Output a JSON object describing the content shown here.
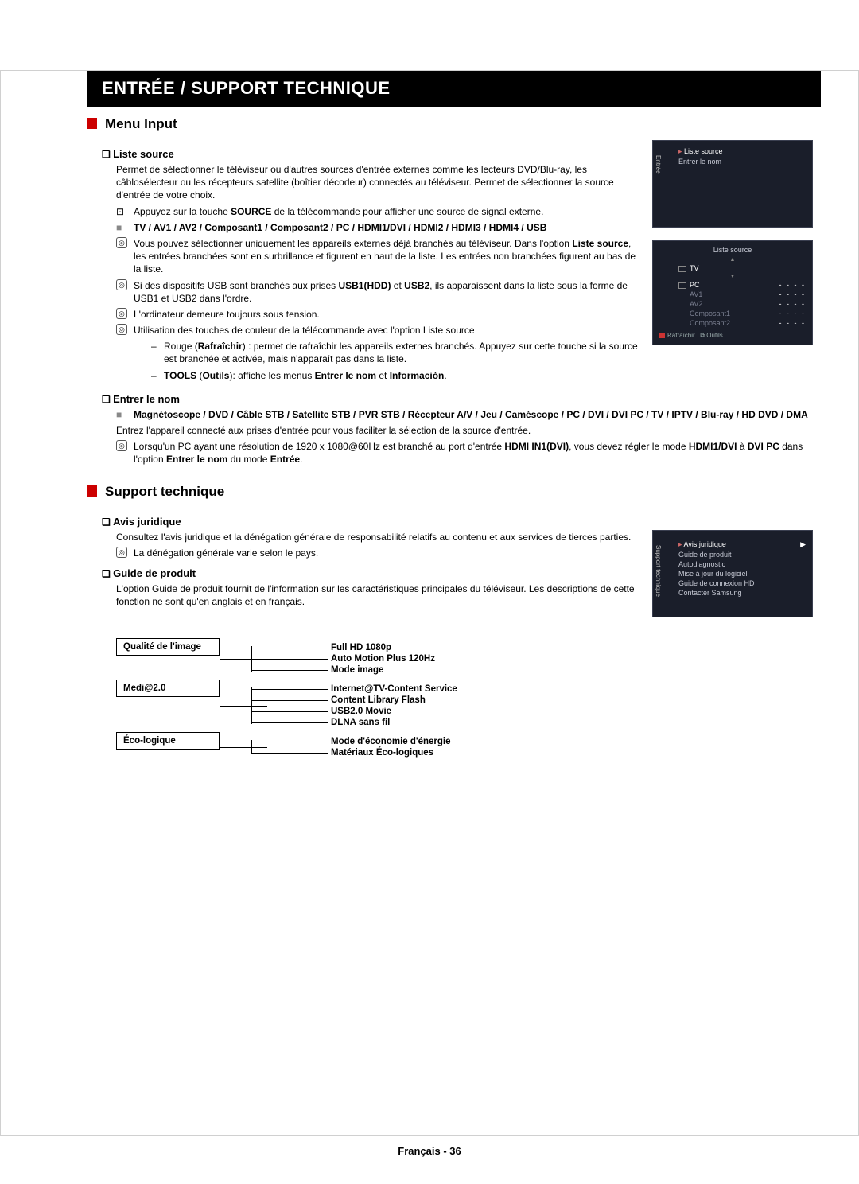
{
  "banner": "ENTRÉE / SUPPORT TECHNIQUE",
  "section1": {
    "title": "Menu Input",
    "liste_source": {
      "heading": "Liste source",
      "p1": "Permet de sélectionner le téléviseur ou d'autres sources d'entrée externes comme les lecteurs DVD/Blu-ray, les câblosélecteur ou les récepteurs satellite (boîtier décodeur) connectés au téléviseur. Permet de sélectionner la source d'entrée de votre choix.",
      "remote_pre": "Appuyez sur la touche ",
      "remote_b": "SOURCE",
      "remote_post": " de la télécommande pour afficher une source de signal externe.",
      "list": "TV / AV1 / AV2 / Composant1 / Composant2 / PC / HDMI1/DVI / HDMI2 / HDMI3 / HDMI4 / USB",
      "n1a": "Vous pouvez sélectionner uniquement les appareils externes déjà branchés au téléviseur. Dans l'option ",
      "n1b": "Liste source",
      "n1c": ", les entrées branchées sont en surbrillance et figurent en haut de la liste. Les entrées non branchées figurent au bas de la liste.",
      "n2a": "Si des dispositifs USB sont branchés aux prises ",
      "n2b": "USB1(HDD)",
      "n2c": " et ",
      "n2d": "USB2",
      "n2e": ", ils apparaissent dans la liste sous la forme de USB1 et USB2 dans l'ordre.",
      "n3": "L'ordinateur demeure toujours sous tension.",
      "n4": "Utilisation des touches de couleur de la télécommande avec l'option Liste source",
      "d1a": "Rouge (",
      "d1b": "Rafraîchir",
      "d1c": ") : permet de rafraîchir les appareils externes branchés. Appuyez sur cette touche si la source est branchée et activée, mais n'apparaît pas dans la liste.",
      "d2a": "TOOLS",
      "d2b": " (",
      "d2c": "Outils",
      "d2d": "): affiche les menus ",
      "d2e": "Entrer le nom",
      "d2f": " et ",
      "d2g": "Información",
      "d2h": "."
    },
    "entrer": {
      "heading": "Entrer le nom",
      "list": "Magnétoscope / DVD / Câble STB / Satellite STB / PVR STB / Récepteur A/V / Jeu / Caméscope / PC / DVI / DVI PC / TV / IPTV / Blu-ray / HD DVD / DMA",
      "p1": "Entrez l'appareil connecté aux prises d'entrée pour vous faciliter la sélection de la source d'entrée.",
      "n1a": "Lorsqu'un PC ayant une résolution de 1920 x 1080@60Hz est branché au port d'entrée ",
      "n1b": "HDMI IN1(DVI)",
      "n1c": ", vous devez régler le mode ",
      "n1d": "HDMI1/DVI",
      "n1e": " à ",
      "n1f": "DVI PC",
      "n1g": " dans l'option ",
      "n1h": "Entrer le nom",
      "n1i": " du mode ",
      "n1j": "Entrée",
      "n1k": "."
    }
  },
  "section2": {
    "title": "Support technique",
    "avis": {
      "heading": "Avis juridique",
      "p1": "Consultez l'avis juridique et la dénégation générale de responsabilité relatifs au contenu et aux services de tierces parties.",
      "n1": "La dénégation générale varie selon le pays."
    },
    "guide": {
      "heading": "Guide de produit",
      "p1": "L'option Guide de produit fournit de l'information sur les caractéristiques principales du téléviseur. Les descriptions de cette fonction ne sont qu'en anglais et en français."
    },
    "table": {
      "r1": {
        "left": "Qualité de l'image",
        "items": [
          "Full HD 1080p",
          "Auto Motion Plus 120Hz",
          "Mode image"
        ]
      },
      "r2": {
        "left": "Medi@2.0",
        "items": [
          "Internet@TV-Content Service",
          "Content Library Flash",
          "USB2.0 Movie",
          "DLNA sans fil"
        ]
      },
      "r3": {
        "left": "Éco-logique",
        "items": [
          "Mode d'économie d'énergie",
          "Matériaux Éco-logiques"
        ]
      }
    }
  },
  "osd1": {
    "side": "Entrée",
    "title": "Liste source",
    "row2": "Entrer le nom"
  },
  "osd2": {
    "header": "Liste source",
    "tv": "TV",
    "pc": "PC",
    "av1": "AV1",
    "av2": "AV2",
    "c1": "Composant1",
    "c2": "Composant2",
    "dash": "- - - -",
    "ft_refresh": "Rafraîchir",
    "ft_tools": "Outils"
  },
  "osd3": {
    "side": "Support technique",
    "title": "Avis juridique",
    "i1": "Guide de produit",
    "i2": "Autodiagnostic",
    "i3": "Mise à jour du logiciel",
    "i4": "Guide de connexion HD",
    "i5": "Contacter Samsung"
  },
  "footer_a": "Français - ",
  "footer_b": "36"
}
